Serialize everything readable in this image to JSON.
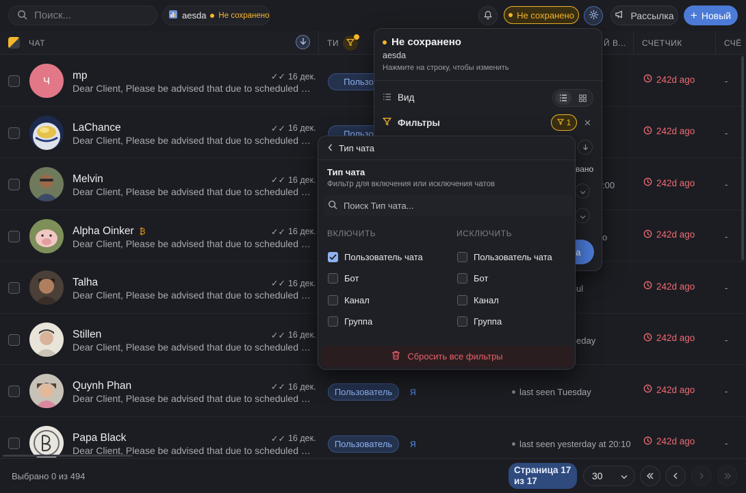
{
  "topbar": {
    "search_placeholder": "Поиск...",
    "view_name": "aesda",
    "view_status": "Не сохранено",
    "unsaved_chip": "Не сохранено",
    "mail_label": "Рассылка",
    "new_label": "Новый"
  },
  "table": {
    "columns": {
      "chat": "ЧАТ",
      "type": "ТИ",
      "last_seen": "Й В...",
      "counter": "СЧЕТЧИК",
      "counter2": "СЧЁ"
    },
    "rows": [
      {
        "initial": "Ч",
        "name": "mp",
        "preview": "Dear Client, Please be advised that due to scheduled ma...",
        "date": "16 дек.",
        "type": "Пользова",
        "ya": "",
        "seen": "",
        "counter": "242d ago",
        "dash": "-"
      },
      {
        "initial": "",
        "name": "LaChance",
        "preview": "Dear Client, Please be advised that due to scheduled ma...",
        "date": "16 дек.",
        "type": "Пользова",
        "ya": "",
        "seen": "",
        "counter": "242d ago",
        "dash": "-"
      },
      {
        "initial": "",
        "name": "Melvin",
        "preview": "Dear Client, Please be advised that due to scheduled ma...",
        "date": "16 дек.",
        "type": "",
        "ya": "",
        "seen": ":00",
        "counter": "242d ago",
        "dash": "-"
      },
      {
        "initial": "",
        "name": "Alpha Oinker",
        "badge": "₿",
        "preview": "Dear Client, Please be advised that due to scheduled ma...",
        "date": "16 дек.",
        "type": "",
        "ya": "",
        "seen": "o",
        "counter": "242d ago",
        "dash": "-"
      },
      {
        "initial": "",
        "name": "Talha",
        "preview": "Dear Client, Please be advised that due to scheduled ma...",
        "date": "16 дек.",
        "type": "",
        "ya": "",
        "seen": "ul",
        "counter": "242d ago",
        "dash": "-"
      },
      {
        "initial": "",
        "name": "Stillen",
        "preview": "Dear Client, Please be advised that due to scheduled ma...",
        "date": "16 дек.",
        "type": "",
        "ya": "",
        "seen": "eday",
        "counter": "242d ago",
        "dash": "-"
      },
      {
        "initial": "",
        "name": "Quynh Phan",
        "preview": "Dear Client, Please be advised that due to scheduled ma...",
        "date": "16 дек.",
        "type": "Пользователь",
        "ya": "Я",
        "seen": "last seen Tuesday",
        "counter": "242d ago",
        "dash": "-"
      },
      {
        "initial": "",
        "name": "Papa Black",
        "preview": "Dear Client, Please be advised that due to scheduled ma...",
        "date": "16 дек.",
        "type": "Пользователь",
        "ya": "Я",
        "seen": "last seen yesterday at 20:10",
        "counter": "242d ago",
        "dash": "-"
      }
    ]
  },
  "footer": {
    "selected": "Выбрано 0 из 494",
    "page_line1": "Страница 17",
    "page_line2": "из 17",
    "per_page": "30"
  },
  "view_popup": {
    "title": "Не сохранено",
    "name": "aesda",
    "hint": "Нажмите на строку, чтобы изменить",
    "view_label": "Вид",
    "filters_label": "Фильтры",
    "filter_count": "1",
    "partial_text": "вано",
    "save_partial": "da"
  },
  "filter_popup": {
    "back_label": "Тип чата",
    "title": "Тип чата",
    "subtitle": "Фильтр для включения или исключения чатов",
    "search_placeholder": "Поиск Тип чата...",
    "include_head": "ВКЛЮЧИТЬ",
    "exclude_head": "ИСКЛЮЧИТЬ",
    "options": [
      "Пользователь чата",
      "Бот",
      "Канал",
      "Группа"
    ],
    "include_checked": [
      true,
      false,
      false,
      false
    ],
    "exclude_checked": [
      false,
      false,
      false,
      false
    ],
    "reset_label": "Сбросить все фильтры"
  },
  "colors": {
    "accent": "#4b7bd6",
    "warning": "#f5b72b",
    "danger": "#ef6a72"
  }
}
